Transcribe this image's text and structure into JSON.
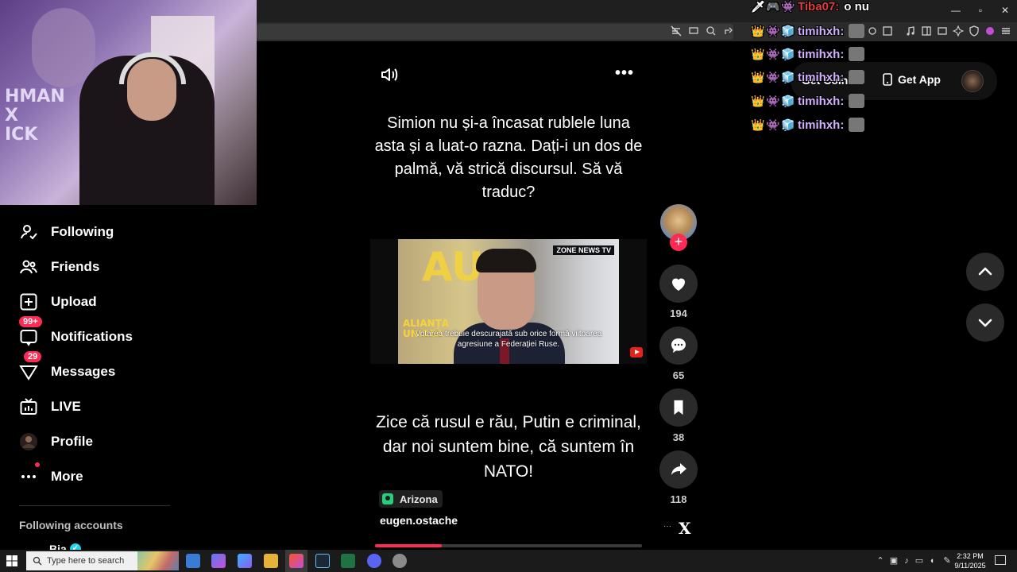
{
  "browser": {
    "window_controls": {
      "minimize": "—",
      "restore": "▫",
      "close": "✕"
    }
  },
  "webcam": {
    "hoodie_text": "HMAN\nX\nICK"
  },
  "sidebar": {
    "items": [
      {
        "label": "Following",
        "icon": "user-follow-icon"
      },
      {
        "label": "Friends",
        "icon": "friends-icon"
      },
      {
        "label": "Upload",
        "icon": "upload-icon"
      },
      {
        "label": "Notifications",
        "icon": "notification-icon",
        "badge": "99+"
      },
      {
        "label": "Messages",
        "icon": "messages-icon",
        "badge": "29"
      },
      {
        "label": "LIVE",
        "icon": "live-icon"
      },
      {
        "label": "Profile",
        "icon": "avatar"
      },
      {
        "label": "More",
        "icon": "more-icon"
      }
    ],
    "following_accounts_title": "Following accounts",
    "following_accounts": [
      {
        "name": "Bia",
        "verified": true
      }
    ]
  },
  "header": {
    "get_coins": "Get Coins",
    "get_app": "Get App"
  },
  "post": {
    "caption_top": "Simion nu și-a încasat rublele luna asta și a luat-o razna. Dați-i un dos de palmă, vă strică discursul. Să vă traduc?",
    "caption_bottom": "Zice că rusul e rău, Putin e criminal, dar noi suntem bine, că suntem în NATO!",
    "video": {
      "network": "ZONE NEWS TV",
      "subtitle": "Votarea trebuie descurajată sub orice formă viitoarea agresiune a Federației Ruse.",
      "logo_letters": "AU",
      "logo_text": "ALIANȚA\nUNIREA"
    },
    "location": "Arizona",
    "author": "eugen.ostache",
    "progress": 0.25,
    "likes": "194",
    "comments": "65",
    "bookmarks": "38",
    "shares": "118"
  },
  "chat": [
    {
      "user": "Tiba07:",
      "message": "o nu",
      "color": "#e43b3b"
    },
    {
      "user": "timihxh:",
      "message": ""
    },
    {
      "user": "timihxh:",
      "message": ""
    },
    {
      "user": "timihxh:",
      "message": ""
    },
    {
      "user": "timihxh:",
      "message": ""
    },
    {
      "user": "timihxh:",
      "message": ""
    }
  ],
  "taskbar": {
    "search_placeholder": "Type here to search",
    "time": "2:32 PM",
    "date": "9/11/2025"
  },
  "colors": {
    "accent": "#fe2c55",
    "location_pin": "#25d07d",
    "chat_name": "#d2b1ff"
  }
}
